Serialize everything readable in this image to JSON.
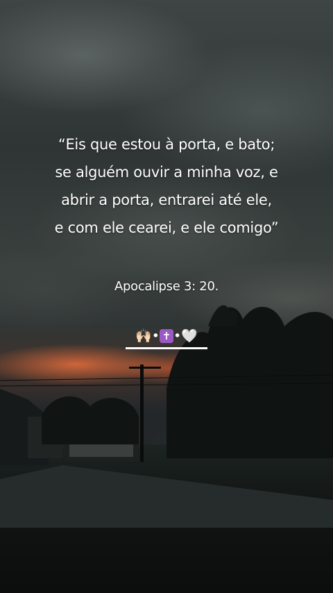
{
  "quote": {
    "lines": [
      "“Eis que estou à porta, e bato;",
      "se alguém ouvir a minha voz, e",
      "abrir a porta, entrarei até ele,",
      "e com ele cearei, e ele comigo”"
    ]
  },
  "reference": "Apocalipse 3: 20.",
  "emojis": {
    "hands": "🙌🏻",
    "dot1": "•",
    "cross": "✝",
    "dot2": "•",
    "heart": "🤍"
  }
}
